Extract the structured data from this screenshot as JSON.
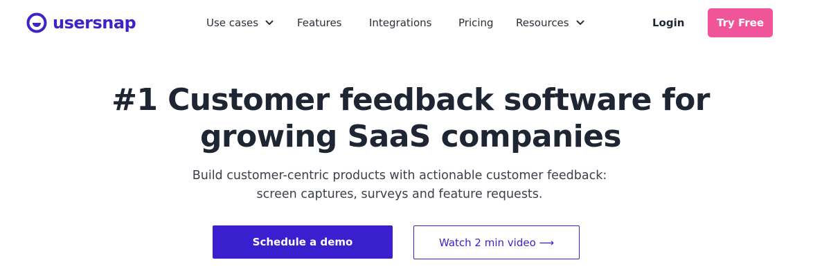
{
  "brand": {
    "name": "usersnap",
    "color": "#3e23c9"
  },
  "nav": {
    "items": [
      {
        "label": "Use cases",
        "has_dropdown": true
      },
      {
        "label": "Features",
        "has_dropdown": false
      },
      {
        "label": "Integrations",
        "has_dropdown": false
      },
      {
        "label": "Pricing",
        "has_dropdown": false
      },
      {
        "label": "Resources",
        "has_dropdown": true
      }
    ],
    "login_label": "Login",
    "cta_label": "Try Free",
    "cta_color": "#f0559a"
  },
  "hero": {
    "title_lines": [
      "#1 Customer feedback software for",
      "growing SaaS companies"
    ],
    "subtitle_lines": [
      "Build customer-centric products with actionable customer feedback:",
      "screen captures, surveys and feature requests."
    ],
    "primary_button": "Schedule a demo",
    "secondary_button": "Watch 2 min video ⟶",
    "primary_color": "#3a1fce"
  }
}
